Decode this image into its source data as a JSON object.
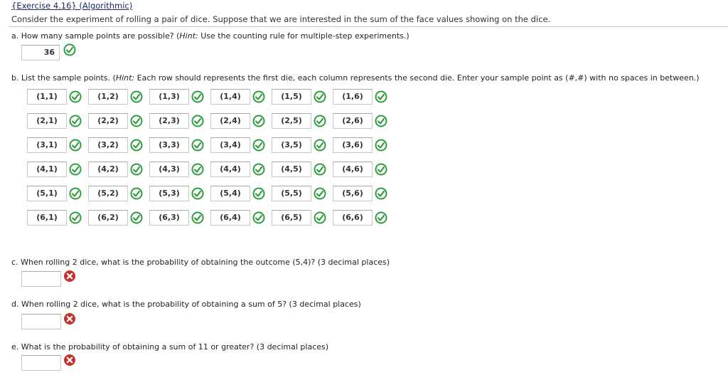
{
  "title": "{Exercise 4.16} (Algorithmic)",
  "intro": "Consider the experiment of rolling a pair of dice. Suppose that we are interested in the sum of the face values showing on the dice.",
  "part_a": {
    "question_prefix": "a. How many sample points are possible? (",
    "hint_label": "Hint:",
    "hint_text": " Use the counting rule for multiple-step experiments.)",
    "answer": "36",
    "status": "correct"
  },
  "part_b": {
    "question_prefix": "b. List the sample points. (",
    "hint_label": "Hint:",
    "hint_text": " Each row should represents the first die, each column represents the second die. Enter your sample point as (#,#) with no spaces in between.)",
    "rows": [
      [
        "(1,1)",
        "(1,2)",
        "(1,3)",
        "(1,4)",
        "(1,5)",
        "(1,6)"
      ],
      [
        "(2,1)",
        "(2,2)",
        "(2,3)",
        "(2,4)",
        "(2,5)",
        "(2,6)"
      ],
      [
        "(3,1)",
        "(3,2)",
        "(3,3)",
        "(3,4)",
        "(3,5)",
        "(3,6)"
      ],
      [
        "(4,1)",
        "(4,2)",
        "(4,3)",
        "(4,4)",
        "(4,5)",
        "(4,6)"
      ],
      [
        "(5,1)",
        "(5,2)",
        "(5,3)",
        "(5,4)",
        "(5,5)",
        "(5,6)"
      ],
      [
        "(6,1)",
        "(6,2)",
        "(6,3)",
        "(6,4)",
        "(6,5)",
        "(6,6)"
      ]
    ],
    "status": "correct"
  },
  "part_c": {
    "question": "c. When rolling 2 dice, what is the probability of obtaining the outcome (5,4)? (3 decimal places)",
    "answer": "",
    "status": "incorrect"
  },
  "part_d": {
    "question": "d. When rolling 2 dice, what is the probability of obtaining a sum of 5? (3 decimal places)",
    "answer": "",
    "status": "incorrect"
  },
  "part_e": {
    "question": "e. What is the probability of obtaining a sum of 11 or greater? (3 decimal places)",
    "answer": "",
    "status": "incorrect"
  },
  "colors": {
    "correct": "#2e9e3e",
    "incorrect": "#c8302a",
    "title_link": "#1a2a66"
  },
  "icons": {
    "correct": "check-circle-icon",
    "incorrect": "x-circle-icon"
  }
}
